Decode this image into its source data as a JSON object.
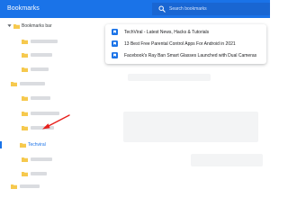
{
  "header": {
    "title": "Bookmarks",
    "search_placeholder": "Search bookmarks",
    "search_icon": "search-icon",
    "accent_color": "#1a73e8"
  },
  "sidebar": {
    "root_label": "Bookmarks bar",
    "selected_folder_label": "Techviral",
    "folder_color": "#f6c94e",
    "folder_icon": "folder-icon"
  },
  "bookmarks": [
    {
      "title": "TechViral - Latest News, Hacks & Tutorials",
      "icon": "techviral-favicon-icon"
    },
    {
      "title": "13 Best Free Parental Control Apps For Android in 2021",
      "icon": "techviral-favicon-icon"
    },
    {
      "title": "Facebook's Ray Ban Smart Glasses Launched with Dual Cameras",
      "icon": "techviral-favicon-icon"
    }
  ]
}
